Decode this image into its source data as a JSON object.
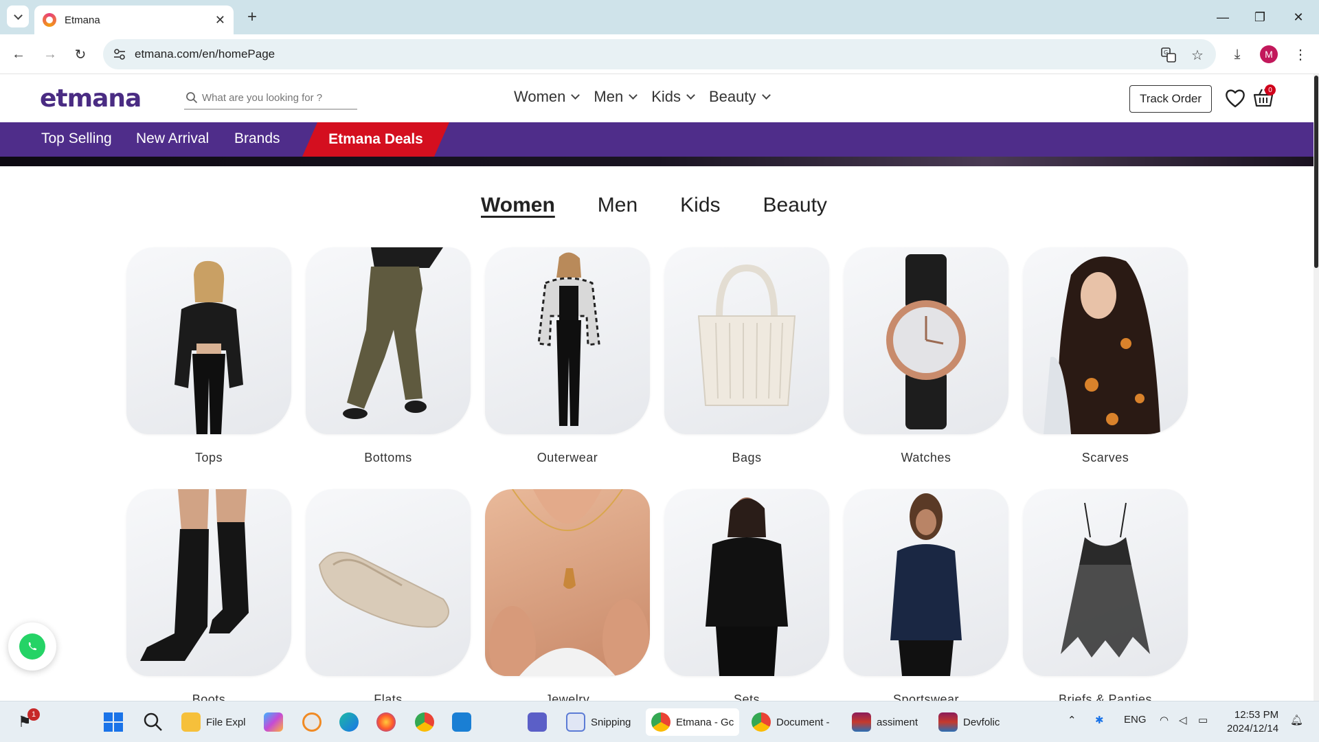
{
  "browser": {
    "tab_title": "Etmana",
    "url": "etmana.com/en/homePage",
    "profile_initial": "M"
  },
  "header": {
    "logo": "etmana",
    "search_placeholder": "What are you looking for ?",
    "nav": [
      "Women",
      "Men",
      "Kids",
      "Beauty"
    ],
    "track_order": "Track Order",
    "cart_count": "0"
  },
  "subnav": {
    "items": [
      "Top Selling",
      "New Arrival",
      "Brands"
    ],
    "deals": "Etmana Deals"
  },
  "category_tabs": {
    "items": [
      "Women",
      "Men",
      "Kids",
      "Beauty"
    ],
    "active": "Women"
  },
  "categories": [
    "Tops",
    "Bottoms",
    "Outerwear",
    "Bags",
    "Watches",
    "Scarves",
    "Boots",
    "Flats",
    "Jewelry",
    "Sets",
    "Sportswear",
    "Briefs & Panties"
  ],
  "taskbar": {
    "notification_count": "1",
    "apps": [
      "File Expl",
      "Snipping",
      "Etmana - Gc",
      "Document -",
      "assiment",
      "Devfolic"
    ],
    "language": "ENG",
    "time": "12:53 PM",
    "date": "2024/12/14"
  },
  "colors": {
    "brand_purple": "#4f2d8a",
    "deals_red": "#d40f1f",
    "whatsapp_green": "#25d366"
  }
}
